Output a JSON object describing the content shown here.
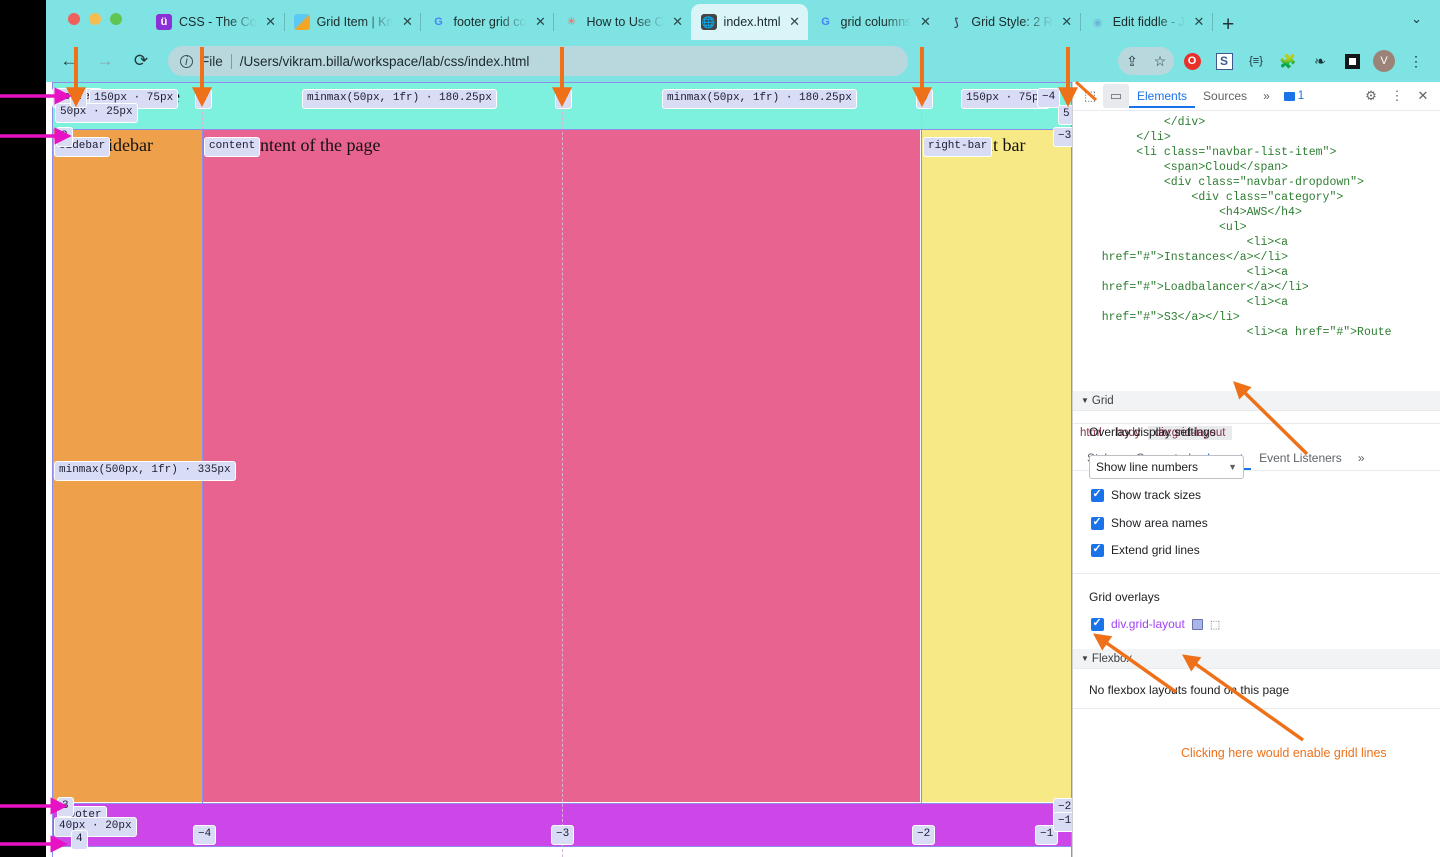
{
  "browser": {
    "traffic_lights": [
      "close",
      "minimize",
      "maximize"
    ],
    "tabs": [
      {
        "favicon": "u-logo-icon",
        "title": "CSS - The Co",
        "active": false
      },
      {
        "favicon": "kn-logo-icon",
        "title": "Grid Item | Kn",
        "active": false
      },
      {
        "favicon": "google-icon",
        "title": "footer grid co",
        "active": false
      },
      {
        "favicon": "asterisk-icon",
        "title": "How to Use C",
        "active": false
      },
      {
        "favicon": "globe-icon",
        "title": "index.html",
        "active": true
      },
      {
        "favicon": "google-icon",
        "title": "grid columns",
        "active": false
      },
      {
        "favicon": "lightning-icon",
        "title": "Grid Style: 2 R",
        "active": false
      },
      {
        "favicon": "codepen-icon",
        "title": "Edit fiddle - J",
        "active": false
      }
    ],
    "new_tab_label": "+",
    "tab_list_chevron": "⌄",
    "nav": {
      "back": "←",
      "forward": "→",
      "reload": "⟳"
    },
    "omnibox": {
      "info_icon": "ⓘ",
      "scheme_label": "File",
      "url": "/Users/vikram.billa/workspace/lab/css/index.html"
    },
    "toolbar_icons": [
      "share-icon",
      "bookmark-star-icon",
      "opera-extension-icon",
      "s-extension-icon",
      "code-extension-icon",
      "puzzle-extension-icon",
      "leaf-extension-icon",
      "square-extension-icon",
      "profile-avatar",
      "kebab-menu-icon"
    ],
    "avatar_letter": "V"
  },
  "page": {
    "header_text": "header goes here",
    "sidebar_text": "sidebar",
    "content_text": "content of the page",
    "right_bar_text": "right bar",
    "footer_text": "footer"
  },
  "grid_overlay": {
    "area_labels": {
      "header": "header",
      "sidebar": "sidebar",
      "content": "content",
      "right_bar": "right-bar",
      "footer": "footer"
    },
    "column_track_sizes": [
      "150px · 75px",
      "minmax(50px, 1fr) · 180.25px",
      "minmax(50px, 1fr) · 180.25px",
      "150px · 75px"
    ],
    "row_track_sizes": [
      "50px · 25px",
      "minmax(500px, 1fr) · 335px",
      "40px · 20px"
    ],
    "column_line_numbers_positive": [
      "1",
      "2",
      "3",
      "4",
      "5"
    ],
    "column_line_numbers_negative": [
      "−4",
      "−3",
      "−2",
      "−1"
    ],
    "row_line_numbers_positive": [
      "1",
      "2",
      "3",
      "4"
    ],
    "row_line_numbers_negative": [
      "−3",
      "−2",
      "−1"
    ]
  },
  "devtools": {
    "toolbar": {
      "inspect_icon": "inspect-element-icon",
      "device_icon": "device-toolbar-icon",
      "tabs": [
        {
          "label": "Elements",
          "active": true
        },
        {
          "label": "Sources",
          "active": false
        }
      ],
      "more_tabs": "»",
      "message_count": "1",
      "settings_icon": "gear-icon",
      "kebab_icon": "kebab-menu-icon",
      "close_icon": "close-icon"
    },
    "dom_lines": [
      "            </div>",
      "        </li>",
      "        <li class=\"navbar-list-item\">",
      "            <span>Cloud</span>",
      "            <div class=\"navbar-dropdown\">",
      "                <div class=\"category\">",
      "                    <h4>AWS</h4>",
      "                    <ul>",
      "                        <li><a",
      "   href=\"#\">Instances</a></li>",
      "                        <li><a",
      "   href=\"#\">Loadbalancer</a></li>",
      "                        <li><a",
      "   href=\"#\">S3</a></li>",
      "                        <li><a href=\"#\">Route"
    ],
    "breadcrumbs": [
      {
        "label": "html",
        "active": false
      },
      {
        "label": "body",
        "active": false
      },
      {
        "label": "div.grid-layout",
        "active": true
      }
    ],
    "sub_tabs": [
      {
        "label": "Styles",
        "active": false
      },
      {
        "label": "Computed",
        "active": false
      },
      {
        "label": "Layout",
        "active": true
      },
      {
        "label": "Event Listeners",
        "active": false
      }
    ],
    "sub_tabs_more": "»",
    "grid_section": {
      "title": "Grid",
      "overlay_settings_label": "Overlay display settings",
      "line_numbers_select": "Show line numbers",
      "checkboxes": [
        {
          "label": "Show track sizes",
          "checked": true
        },
        {
          "label": "Show area names",
          "checked": true
        },
        {
          "label": "Extend grid lines",
          "checked": true
        }
      ],
      "grid_overlays_label": "Grid overlays",
      "overlay_item": "div.grid-layout",
      "overlay_item_checked": true
    },
    "flexbox_section": {
      "title": "Flexbox",
      "empty_message": "No flexbox layouts found on this page"
    },
    "annotation_note": "Clicking here would enable gridl lines"
  },
  "colors": {
    "chrome_bg": "#7fe3e3",
    "tab_active_bg": "#d9f5f8",
    "omnibox_bg": "#b9d8dd",
    "header_area": "#7ef0de",
    "sidebar_area": "#efa04a",
    "content_area": "#e8638f",
    "right_bar_area": "#f7ea86",
    "footer_area": "#cc46e8",
    "grid_badge_bg": "#d9dcf5",
    "grid_line": "#8e8ee8",
    "annotation_orange": "#ee7119",
    "annotation_magenta": "#e612c3",
    "devtools_accent": "#1a73e8"
  }
}
